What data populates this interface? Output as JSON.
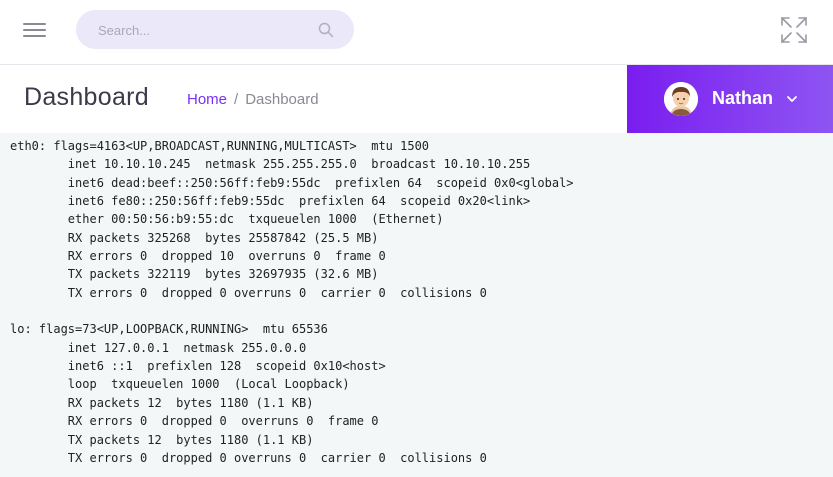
{
  "topbar": {
    "menu_icon": "hamburger-icon",
    "search": {
      "placeholder": "Search...",
      "icon": "search-icon"
    },
    "expand_icon": "expand-icon"
  },
  "header": {
    "title": "Dashboard",
    "breadcrumb": {
      "home": "Home",
      "separator": "/",
      "current": "Dashboard"
    }
  },
  "user": {
    "name": "Nathan",
    "avatar_icon": "avatar-icon",
    "dropdown_icon": "chevron-down-icon"
  },
  "colors": {
    "accent": "#7b2ff7",
    "user_panel_start": "#7a1df0",
    "user_panel_end": "#8e55f2",
    "search_bg": "#ebe8f9",
    "terminal_bg": "#f3f7f8"
  },
  "terminal": {
    "output": "eth0: flags=4163<UP,BROADCAST,RUNNING,MULTICAST>  mtu 1500\n        inet 10.10.10.245  netmask 255.255.255.0  broadcast 10.10.10.255\n        inet6 dead:beef::250:56ff:feb9:55dc  prefixlen 64  scopeid 0x0<global>\n        inet6 fe80::250:56ff:feb9:55dc  prefixlen 64  scopeid 0x20<link>\n        ether 00:50:56:b9:55:dc  txqueuelen 1000  (Ethernet)\n        RX packets 325268  bytes 25587842 (25.5 MB)\n        RX errors 0  dropped 10  overruns 0  frame 0\n        TX packets 322119  bytes 32697935 (32.6 MB)\n        TX errors 0  dropped 0 overruns 0  carrier 0  collisions 0\n\nlo: flags=73<UP,LOOPBACK,RUNNING>  mtu 65536\n        inet 127.0.0.1  netmask 255.0.0.0\n        inet6 ::1  prefixlen 128  scopeid 0x10<host>\n        loop  txqueuelen 1000  (Local Loopback)\n        RX packets 12  bytes 1180 (1.1 KB)\n        RX errors 0  dropped 0  overruns 0  frame 0\n        TX packets 12  bytes 1180 (1.1 KB)\n        TX errors 0  dropped 0 overruns 0  carrier 0  collisions 0"
  }
}
